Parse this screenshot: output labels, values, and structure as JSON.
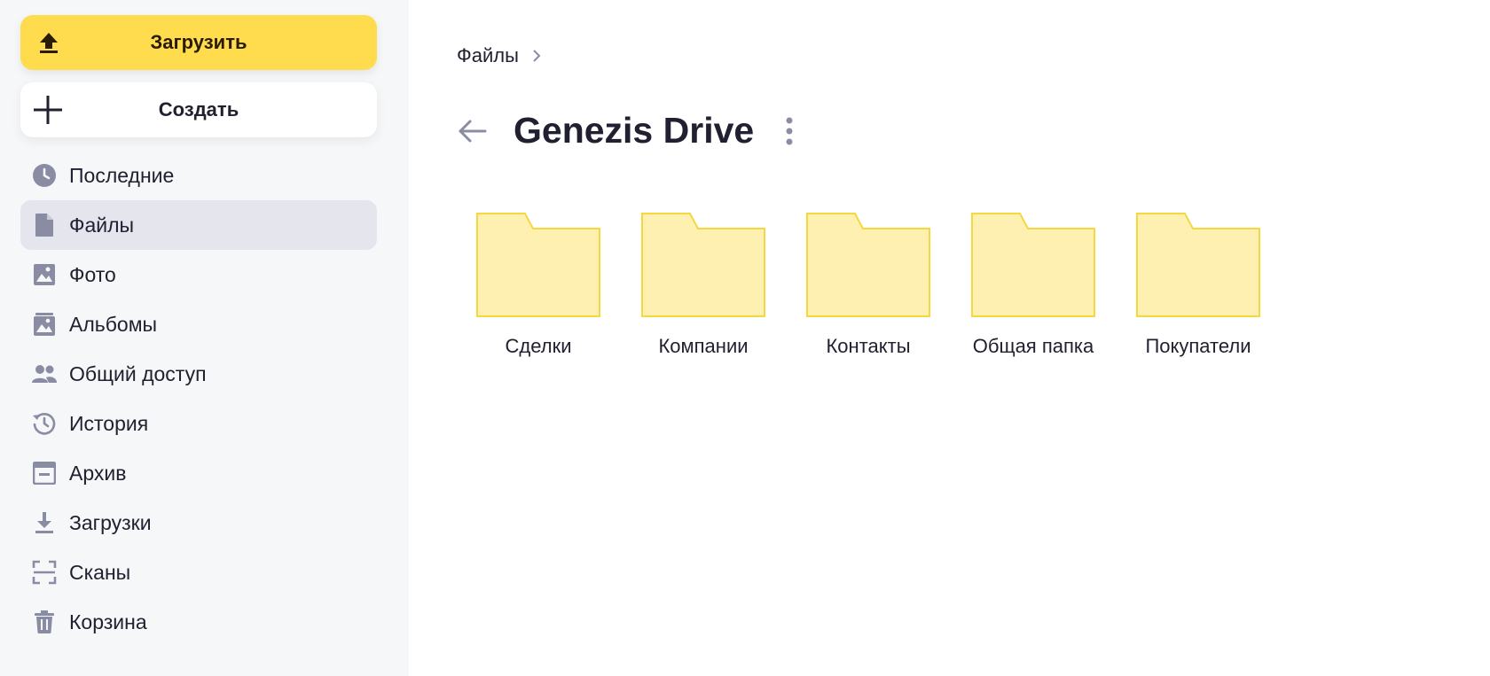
{
  "sidebar": {
    "upload_label": "Загрузить",
    "create_label": "Создать",
    "items": [
      {
        "label": "Последние",
        "icon": "clock-icon"
      },
      {
        "label": "Файлы",
        "icon": "file-icon",
        "active": true
      },
      {
        "label": "Фото",
        "icon": "photo-icon"
      },
      {
        "label": "Альбомы",
        "icon": "album-icon"
      },
      {
        "label": "Общий доступ",
        "icon": "people-icon"
      },
      {
        "label": "История",
        "icon": "history-icon"
      },
      {
        "label": "Архив",
        "icon": "archive-icon"
      },
      {
        "label": "Загрузки",
        "icon": "download-icon"
      },
      {
        "label": "Сканы",
        "icon": "scan-icon"
      },
      {
        "label": "Корзина",
        "icon": "trash-icon"
      }
    ]
  },
  "main": {
    "breadcrumb": "Файлы",
    "title": "Genezis Drive",
    "folders": [
      {
        "name": "Сделки"
      },
      {
        "name": "Компании"
      },
      {
        "name": "Контакты"
      },
      {
        "name": "Общая папка"
      },
      {
        "name": "Покупатели"
      }
    ]
  },
  "colors": {
    "accent": "#ffdc4d",
    "sidebar_bg": "#f6f7f9",
    "active_item": "#e4e5ed",
    "folder_fill": "#fdf0b0",
    "folder_stroke": "#f5d840",
    "icon_gray": "#8a8ca3"
  }
}
